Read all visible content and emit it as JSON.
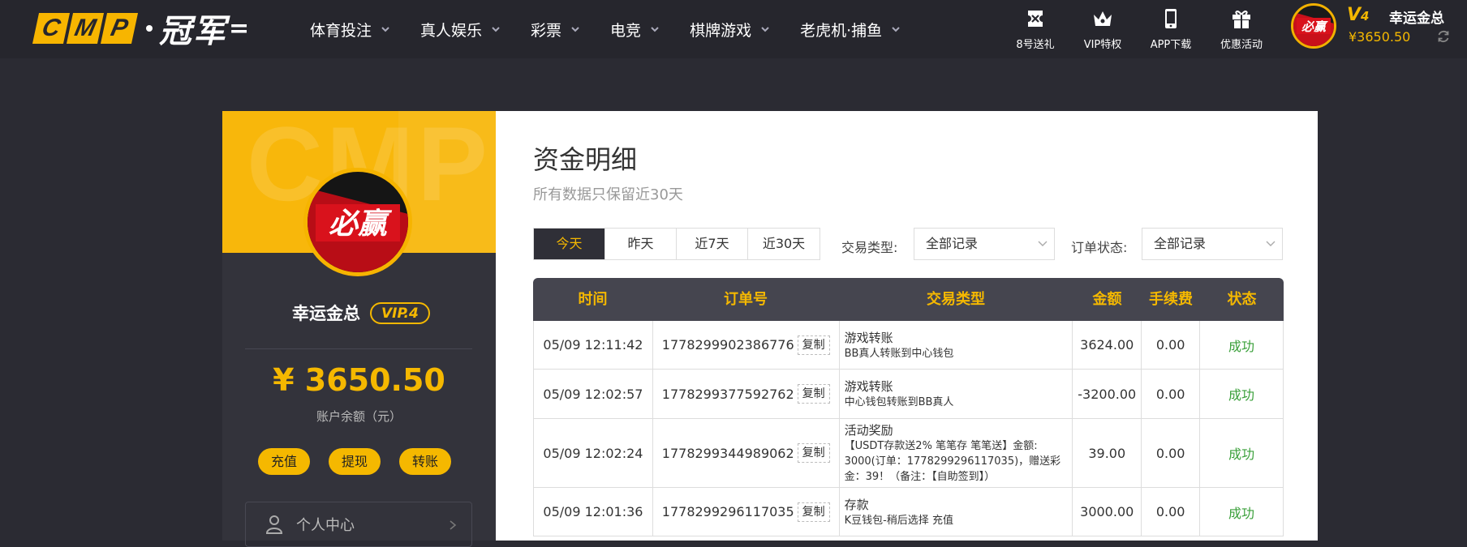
{
  "header": {
    "logo_letters": [
      "C",
      "M",
      "P"
    ],
    "logo_cn": "冠军",
    "nav": [
      "体育投注",
      "真人娱乐",
      "彩票",
      "电竞",
      "棋牌游戏",
      "老虎机·捕鱼"
    ],
    "quick_links": [
      {
        "label": "8号送礼",
        "icon": "ticket-icon"
      },
      {
        "label": "VIP特权",
        "icon": "crown-icon"
      },
      {
        "label": "APP下载",
        "icon": "phone-icon"
      },
      {
        "label": "优惠活动",
        "icon": "gift-icon"
      }
    ],
    "vip_level": "V",
    "vip_level_num": "4",
    "balance": "¥3650.50",
    "username": "幸运金总",
    "avatar_text": "必赢"
  },
  "sidebar": {
    "watermark": "CMP",
    "avatar_text": "必赢",
    "username": "幸运金总",
    "vip_badge": "VIP.4",
    "balance": "¥ 3650.50",
    "balance_label": "账户余额（元）",
    "buttons": [
      "充值",
      "提现",
      "转账"
    ],
    "menu_first": "个人中心"
  },
  "main": {
    "title": "资金明细",
    "subtitle": "所有数据只保留近30天",
    "ranges": [
      "今天",
      "昨天",
      "近7天",
      "近30天"
    ],
    "active_range": "今天",
    "type_filter_label": "交易类型:",
    "type_filter_value": "全部记录",
    "status_filter_label": "订单状态:",
    "status_filter_value": "全部记录",
    "columns": [
      "时间",
      "订单号",
      "交易类型",
      "金额",
      "手续费",
      "状态"
    ],
    "copy_label": "复制",
    "rows": [
      {
        "time": "05/09 12:11:42",
        "order": "1778299902386776",
        "type": "游戏转账",
        "detail": "BB真人转账到中心钱包",
        "amount": "3624.00",
        "fee": "0.00",
        "status": "成功"
      },
      {
        "time": "05/09 12:02:57",
        "order": "1778299377592762",
        "type": "游戏转账",
        "detail": "中心钱包转账到BB真人",
        "amount": "-3200.00",
        "fee": "0.00",
        "status": "成功"
      },
      {
        "time": "05/09 12:02:24",
        "order": "1778299344989062",
        "type": "活动奖励",
        "detail": "【USDT存款送2% 笔笔存 笔笔送】金额: 3000(订单：1778299296117035)，赠送彩金：39！（备注：【自助签到】）",
        "amount": "39.00",
        "fee": "0.00",
        "status": "成功"
      },
      {
        "time": "05/09 12:01:36",
        "order": "1778299296117035",
        "type": "存款",
        "detail": "K豆钱包-稍后选择 充值",
        "amount": "3000.00",
        "fee": "0.00",
        "status": "成功"
      }
    ]
  },
  "colors": {
    "accent": "#f5b800",
    "header_bg": "#26262d",
    "page_bg": "#2b2b33",
    "success": "#3aa03a"
  }
}
